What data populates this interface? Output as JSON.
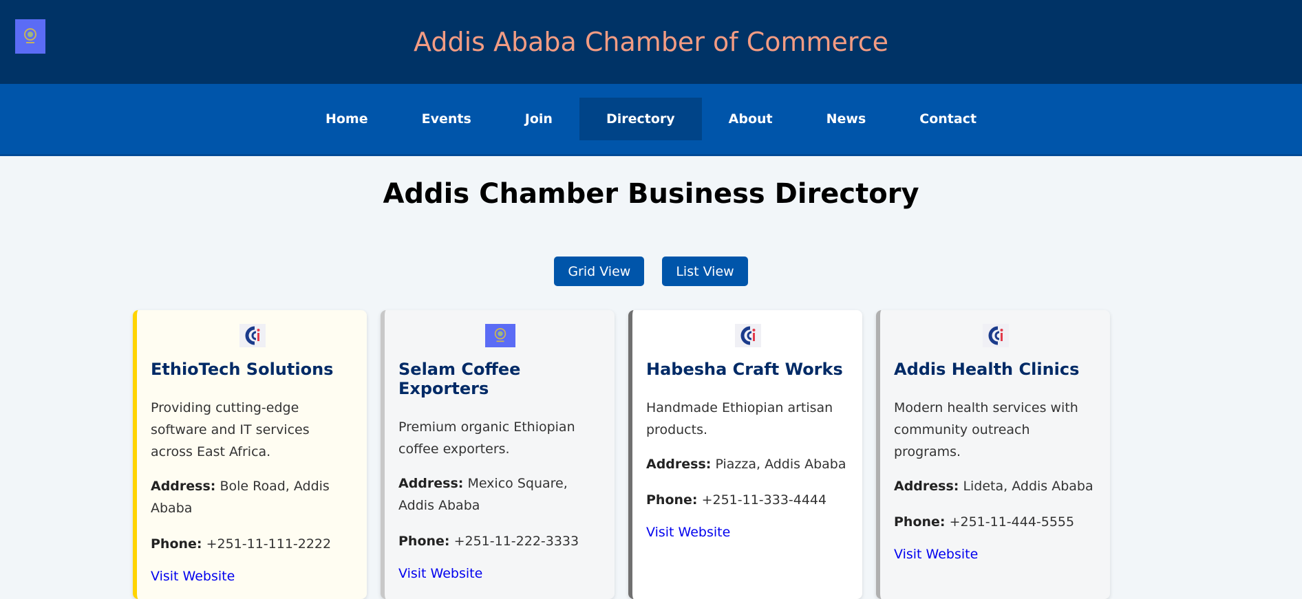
{
  "header": {
    "title": "Addis Ababa Chamber of Commerce"
  },
  "nav": [
    {
      "label": "Home",
      "active": false
    },
    {
      "label": "Events",
      "active": false
    },
    {
      "label": "Join",
      "active": false
    },
    {
      "label": "Directory",
      "active": true
    },
    {
      "label": "About",
      "active": false
    },
    {
      "label": "News",
      "active": false
    },
    {
      "label": "Contact",
      "active": false
    }
  ],
  "page": {
    "heading": "Addis Chamber Business Directory"
  },
  "view_toggle": {
    "grid_label": "Grid View",
    "list_label": "List View"
  },
  "labels": {
    "address": "Address:",
    "phone": "Phone:",
    "visit": "Visit Website"
  },
  "cards": [
    {
      "logo": "ci-logo-icon",
      "name": "EthioTech Solutions",
      "description": "Providing cutting-edge software and IT services across East Africa.",
      "address": "Bole Road, Addis Ababa",
      "phone": "+251-11-111-2222",
      "accent": "#ffd400",
      "bg": "#fffdf2"
    },
    {
      "logo": "chamber-logo-icon",
      "name": "Selam Coffee Exporters",
      "description": "Premium organic Ethiopian coffee exporters.",
      "address": "Mexico Square, Addis Ababa",
      "phone": "+251-11-222-3333",
      "accent": "#c8c8c8",
      "bg": "#f5f6f7"
    },
    {
      "logo": "ci-logo-icon",
      "name": "Habesha Craft Works",
      "description": "Handmade Ethiopian artisan products.",
      "address": "Piazza, Addis Ababa",
      "phone": "+251-11-333-4444",
      "accent": "#707070",
      "bg": "#ffffff"
    },
    {
      "logo": "ci-logo-icon",
      "name": "Addis Health Clinics",
      "description": "Modern health services with community outreach programs.",
      "address": "Lideta, Addis Ababa",
      "phone": "+251-11-444-5555",
      "accent": "#b0b0b0",
      "bg": "#f5f6f7"
    }
  ],
  "colors": {
    "header_bg": "#003366",
    "nav_bg": "#0055aa",
    "title": "#f39c83",
    "card_title": "#002a66"
  }
}
